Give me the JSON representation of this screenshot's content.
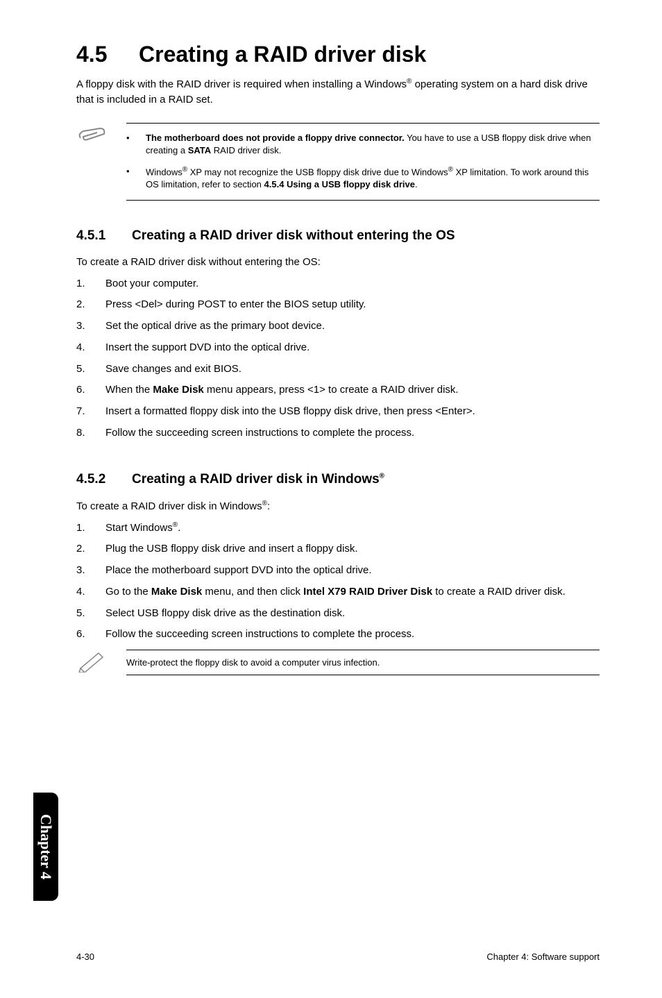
{
  "h1": {
    "num": "4.5",
    "title": "Creating a RAID driver disk"
  },
  "intro": {
    "p1": "A floppy disk with the RAID driver is required when installing a Windows",
    "p2": " operating system on a hard disk drive that is included in a RAID set."
  },
  "note1": {
    "b1a": "The motherboard does not provide a floppy drive connector.",
    "b1b": " You have to use a USB floppy disk drive when creating a ",
    "b1c": "SATA",
    "b1d": " RAID driver disk.",
    "b2a": "Windows",
    "b2b": " XP may not recognize the USB floppy disk drive due to Windows",
    "b2c": " XP limitation. To work around this OS limitation, refer to section ",
    "b2d": "4.5.4 Using a USB floppy disk drive",
    "b2e": "."
  },
  "s451": {
    "num": "4.5.1",
    "title": "Creating a RAID driver disk without entering the OS",
    "lead": "To create a RAID driver disk without entering the OS:",
    "items": [
      "Boot your computer.",
      "Press <Del> during POST to enter the BIOS setup utility.",
      "Set the optical drive as the primary boot device.",
      "Insert the support DVD into the optical drive.",
      "Save changes and exit BIOS.",
      "",
      "Insert a formatted floppy disk into the USB floppy disk drive, then press <Enter>.",
      "Follow the succeeding screen instructions to complete the process."
    ],
    "item6a": "When the ",
    "item6b": "Make Disk",
    "item6c": " menu appears, press <1> to create a RAID driver disk."
  },
  "s452": {
    "num": "4.5.2",
    "title": "Creating a RAID driver disk in Windows",
    "lead1": "To create a RAID driver disk in Windows",
    "lead2": ":",
    "i1a": "Start Windows",
    "i1b": ".",
    "i2": "Plug the USB floppy disk drive and insert a floppy disk.",
    "i3": "Place the motherboard support DVD into the optical drive.",
    "i4a": "Go to the ",
    "i4b": "Make Disk",
    "i4c": " menu, and then click ",
    "i4d": "Intel X79 RAID Driver Disk",
    "i4e": " to create a RAID driver disk.",
    "i5": "Select USB floppy disk drive as the destination disk.",
    "i6": "Follow the succeeding screen instructions to complete the process."
  },
  "pencil": "Write-protect the floppy disk to avoid a computer virus infection.",
  "sideTab": "Chapter 4",
  "footer": {
    "left": "4-30",
    "right": "Chapter 4: Software support"
  },
  "reg": "®",
  "bullet": "•"
}
